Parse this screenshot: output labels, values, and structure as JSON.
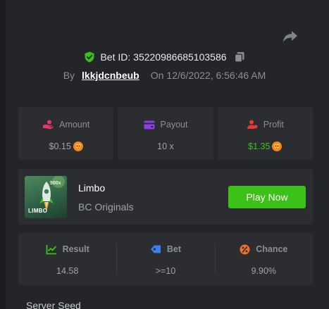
{
  "header": {
    "share_icon": "share-arrow-icon",
    "bet_id_label": "Bet ID: 35220986685103586",
    "by_label": "By",
    "username": "lkkjdcnbeub",
    "on_label": "On",
    "datetime": "12/6/2022, 6:56:46 AM"
  },
  "stats": {
    "amount": {
      "label": "Amount",
      "value": "$0.15",
      "icon": "hand-coin-icon",
      "icon_color": "#e5396c"
    },
    "payout": {
      "label": "Payout",
      "value": "10 x",
      "icon": "wallet-card-icon",
      "icon_color": "#8b3ef0"
    },
    "profit": {
      "label": "Profit",
      "value": "$1.35",
      "icon": "user-coin-icon",
      "icon_color": "#e53939"
    }
  },
  "game": {
    "name": "Limbo",
    "provider": "BC Originals",
    "thumb_logo": "LIMBO",
    "thumb_tag": "500x",
    "play_label": "Play Now"
  },
  "results": {
    "result": {
      "label": "Result",
      "value": "14.58",
      "icon": "chart-check-icon",
      "icon_color": "#3bc117"
    },
    "bet": {
      "label": "Bet",
      "value": ">=10",
      "icon": "tag-icon",
      "icon_color": "#3a7ff0"
    },
    "chance": {
      "label": "Chance",
      "value": "9.90%",
      "icon": "percent-circle-icon",
      "icon_color": "#f0702a"
    }
  },
  "server_seed_label": "Server Seed",
  "colors": {
    "background": "#232528",
    "card": "#2b2d31",
    "accent_green": "#3bc117"
  }
}
